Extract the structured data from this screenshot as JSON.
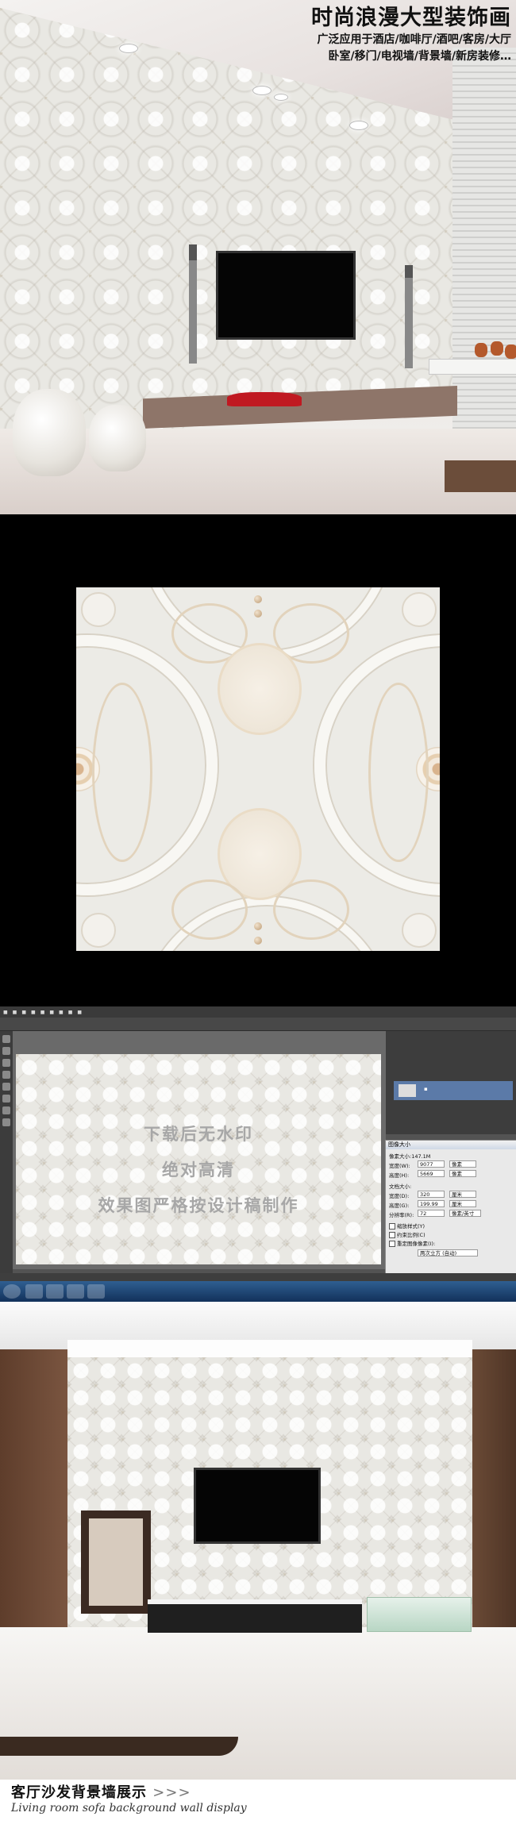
{
  "hero": {
    "title": "时尚浪漫大型装饰画",
    "subtitle_line1": "广泛应用于酒店/咖啡厅/酒吧/客房/大厅",
    "subtitle_line2": "卧室/移门/电视墙/背景墙/新房装修…"
  },
  "photoshop": {
    "watermark_line1": "下载后无水印",
    "watermark_line2": "绝对高清",
    "watermark_line3": "效果图严格按设计稿制作",
    "dialog_title": "图像大小",
    "pixel_size_label": "像素大小:147.1M",
    "width_label": "宽度(W):",
    "width_value": "9077",
    "height_label": "高度(H):",
    "height_value": "5669",
    "unit_pixel": "像素",
    "doc_size_label": "文档大小:",
    "doc_width_label": "宽度(D):",
    "doc_width_value": "320",
    "doc_height_label": "高度(G):",
    "doc_height_value": "199.99",
    "unit_cm": "厘米",
    "resolution_label": "分辨率(R):",
    "resolution_value": "72",
    "unit_ppi": "像素/英寸",
    "check_scale_styles": "缩放样式(Y)",
    "check_constrain": "约束比例(C)",
    "check_resample": "重定图像像素(I):",
    "resample_method": "两次立方 (自动)"
  },
  "caption": {
    "cn": "客厅沙发背景墙展示",
    "arrows": ">>>",
    "en": "Living room sofa background wall display"
  },
  "colors": {
    "accent_red": "#c01921",
    "wall_base": "#e9e8e3",
    "ps_bg": "#535353"
  }
}
